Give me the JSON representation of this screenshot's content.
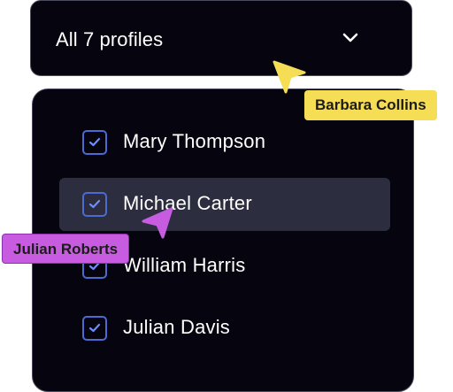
{
  "dropdown": {
    "label": "All 7 profiles",
    "chevron_icon": "chevron-down-icon"
  },
  "menu": {
    "items": [
      {
        "label": "Mary Thompson",
        "checked": true,
        "hovered": false
      },
      {
        "label": "Michael Carter",
        "checked": true,
        "hovered": true
      },
      {
        "label": "William Harris",
        "checked": true,
        "hovered": false
      },
      {
        "label": "Julian Davis",
        "checked": true,
        "hovered": false
      }
    ]
  },
  "collaborators": [
    {
      "name": "Barbara Collins",
      "color": "#f5dd56",
      "cursor_icon": "pointer-cursor-icon"
    },
    {
      "name": "Julian Roberts",
      "color": "#c75ce0",
      "cursor_icon": "pointer-cursor-icon"
    }
  ],
  "colors": {
    "panel_bg": "#05040f",
    "panel_border": "#4a4b5c",
    "hover_bg": "#2d2d40",
    "checkbox_accent": "#4c6bd1"
  }
}
